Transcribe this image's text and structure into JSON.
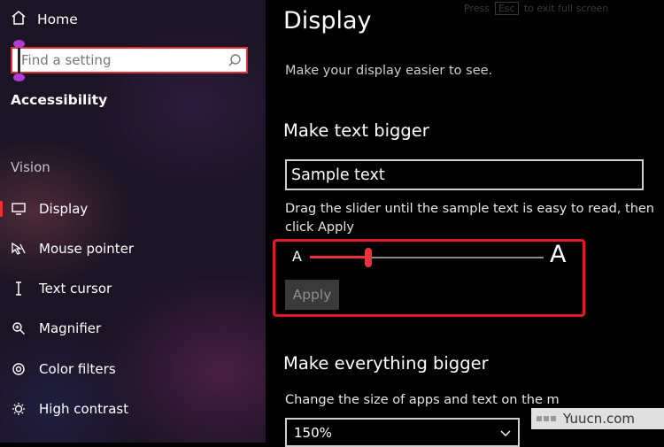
{
  "sidebar": {
    "home_label": "Home",
    "search_placeholder": "Find a setting",
    "section_title": "Accessibility",
    "group_title": "Vision",
    "items": [
      {
        "label": "Display",
        "icon": "monitor-icon",
        "active": true
      },
      {
        "label": "Mouse pointer",
        "icon": "mouse-pointer-icon"
      },
      {
        "label": "Text cursor",
        "icon": "text-cursor-icon"
      },
      {
        "label": "Magnifier",
        "icon": "magnifier-icon"
      },
      {
        "label": "Color filters",
        "icon": "color-filters-icon"
      },
      {
        "label": "High contrast",
        "icon": "high-contrast-icon"
      }
    ]
  },
  "main": {
    "hint_press": "Press",
    "hint_key": "Esc",
    "hint_rest": "to exit full screen",
    "title": "Display",
    "subtitle": "Make your display easier to see.",
    "text_section": {
      "heading": "Make text bigger",
      "sample_text": "Sample text",
      "instruction": "Drag the slider until the sample text is easy to read, then click Apply",
      "slider_min_label": "A",
      "slider_max_label": "A",
      "slider_value_fraction": 0.25,
      "apply_label": "Apply"
    },
    "everything_section": {
      "heading": "Make everything bigger",
      "description": "Change the size of apps and text on the m",
      "scale_value": "150%"
    }
  },
  "watermark": {
    "text": "Yuucn.com"
  },
  "colors": {
    "accent": "#e8323c",
    "highlight_border": "#e01a26",
    "search_border": "#e0303a",
    "caret_marker": "#b23cd6"
  }
}
